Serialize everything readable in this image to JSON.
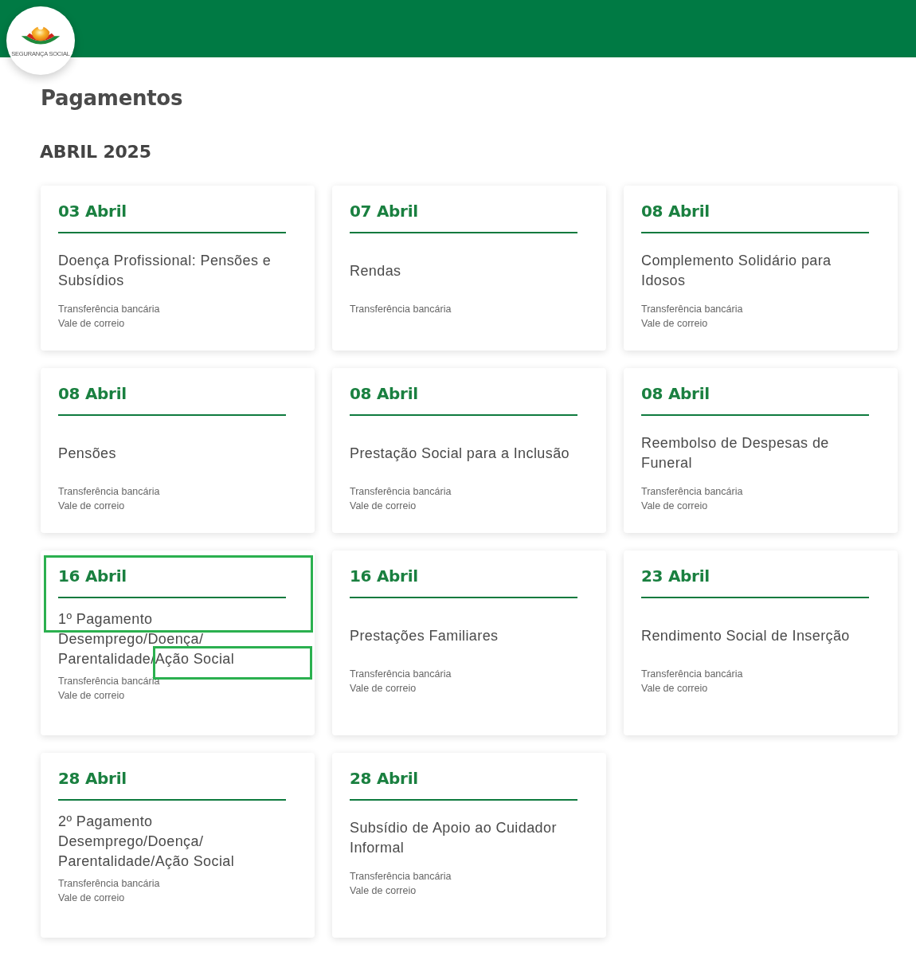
{
  "header": {
    "logo_text": "SEGURANÇA SOCIAL"
  },
  "page_title": "Pagamentos",
  "month": "ABRIL 2025",
  "cards": [
    {
      "date": "03 Abril",
      "title": "Doença Profissional: Pensões e Subsídios",
      "methods": [
        "Transferência bancária",
        "Vale de correio"
      ],
      "highlighted": false
    },
    {
      "date": "07 Abril",
      "title": "Rendas",
      "methods": [
        "Transferência bancária"
      ],
      "highlighted": false
    },
    {
      "date": "08 Abril",
      "title": "Complemento Solidário para Idosos",
      "methods": [
        "Transferência bancária",
        "Vale de correio"
      ],
      "highlighted": false
    },
    {
      "date": "08 Abril",
      "title": "Pensões",
      "methods": [
        "Transferência bancária",
        "Vale de correio"
      ],
      "highlighted": false
    },
    {
      "date": "08 Abril",
      "title": "Prestação Social para a Inclusão",
      "methods": [
        "Transferência bancária",
        "Vale de correio"
      ],
      "highlighted": false
    },
    {
      "date": "08 Abril",
      "title": "Reembolso de Despesas de Funeral",
      "methods": [
        "Transferência bancária",
        "Vale de correio"
      ],
      "highlighted": false
    },
    {
      "date": "16 Abril",
      "title": "1º Pagamento\nDesemprego/Doença/\nParentalidade/Ação Social",
      "methods": [
        "Transferência bancária",
        "Vale de correio"
      ],
      "highlighted": true
    },
    {
      "date": "16 Abril",
      "title": "Prestações Familiares",
      "methods": [
        "Transferência bancária",
        "Vale de correio"
      ],
      "highlighted": false
    },
    {
      "date": "23 Abril",
      "title": "Rendimento Social de Inserção",
      "methods": [
        "Transferência bancária",
        "Vale de correio"
      ],
      "highlighted": false
    },
    {
      "date": "28 Abril",
      "title": "2º Pagamento\nDesemprego/Doença/\nParentalidade/Ação Social",
      "methods": [
        "Transferência bancária",
        "Vale de correio"
      ],
      "highlighted": false
    },
    {
      "date": "28 Abril",
      "title": "Subsídio de Apoio ao Cuidador Informal",
      "methods": [
        "Transferência bancária",
        "Vale de correio"
      ],
      "highlighted": false
    }
  ]
}
